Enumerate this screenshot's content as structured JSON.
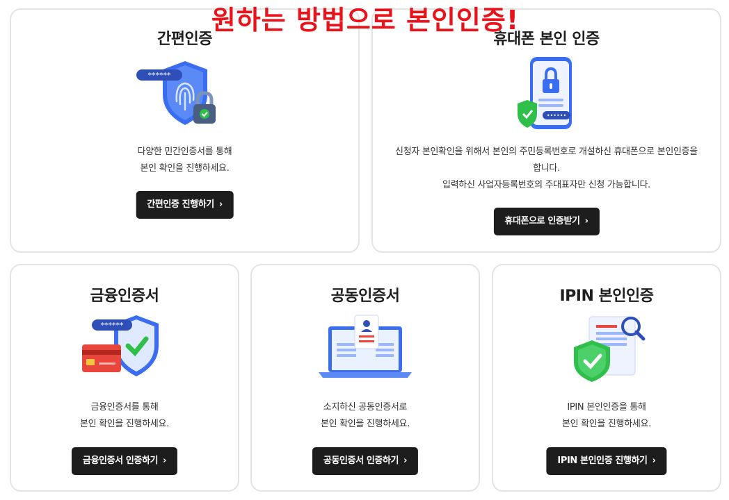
{
  "headline": "원하는 방법으로 본인인증!",
  "cards": {
    "simple": {
      "title": "간편인증",
      "desc": [
        "다양한 민간인증서를 통해",
        "본인 확인을 진행하세요."
      ],
      "button": "간편인증 진행하기",
      "icon": "fingerprint-shield-lock-icon"
    },
    "phone": {
      "title": "휴대폰 본인 인증",
      "desc": [
        "신청자 본인확인을 위해서 본인의 주민등록번호로 개설하신 휴대폰으로 본인인증을",
        "합니다.",
        "입력하신 사업자등록번호의 주대표자만 신청 가능합니다."
      ],
      "button": "휴대폰으로 인증받기",
      "icon": "phone-lock-icon"
    },
    "finance": {
      "title": "금융인증서",
      "desc": [
        "금융인증서를 통해",
        "본인 확인을 진행하세요."
      ],
      "button": "금융인증서 인증하기",
      "icon": "card-shield-icon"
    },
    "joint": {
      "title": "공동인증서",
      "desc": [
        "소지하신 공동인증서로",
        "본인 확인을 진행하세요."
      ],
      "button": "공동인증서 인증하기",
      "icon": "laptop-certificate-icon"
    },
    "ipin": {
      "title": "IPIN 본인인증",
      "desc": [
        "IPIN 본인인증을 통해",
        "본인 확인을 진행하세요."
      ],
      "button": "IPIN 본인인증 진행하기",
      "icon": "document-magnifier-shield-icon"
    }
  },
  "masked_password": "******",
  "colors": {
    "headline": "#e8141b",
    "button_bg": "#1d1d1d",
    "accent_blue": "#3a6df0",
    "check_green": "#2fbf4a",
    "card_red": "#e8453c"
  }
}
